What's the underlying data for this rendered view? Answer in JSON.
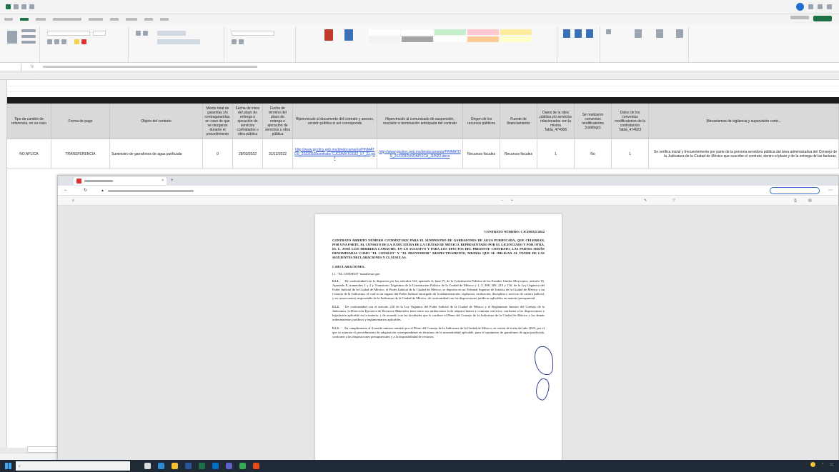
{
  "spreadsheet": {
    "headers": [
      "Tipo de cambio de referencia, en su caso",
      "Forma de pago",
      "Objeto del contrato",
      "Monto total de garantías y/o contragarantías, en caso de que se otorgaran durante el procedimiento",
      "Fecha de inicio del plazo de entrega o ejecución de servicios contratados u obra pública",
      "Fecha de término del plazo de entrega o ejecución de servicios u obra pública",
      "Hipervínculo al documento del contrato y anexos, versión pública si así corresponde",
      "Hipervínculo al comunicado de suspensión, rescisión o terminación anticipada del contrato",
      "Origen de los recursos públicos",
      "Fuente de financiamiento",
      "Datos de la obra pública y/o servicios relacionados con la misma Tabla_474906",
      "Se realizaron convenios modificatorios (catálogo)",
      "Datos de los convenios modificatorios de la contratación Tabla_474923",
      "Mecanismos de vigilancia y supervisión contr..."
    ],
    "row": [
      "NO APLICA",
      "TRANSFERENCIA",
      "Suministro de garrafones de agua purificada",
      "0",
      "28/03/2022",
      "31/12/2022",
      "http://www.pjcdmx.gob.mx/dmdocuments/PINMATDS_20220925contrato/ CJCDMXT/2022_07_21.pdf",
      "http://www.pjcdmx.gob.mx/dmdocuments/PINMATDS_20220925NOAPLICA_JUN22.docx",
      "Recursos fiscales",
      "Recursos fiscales",
      "1",
      "No",
      "1",
      "Se verifica inicial y frecuentemente por parte de la persona servidora pública del área administrativa del Consejo de la Judicatura de la Ciudad de México que suscribe el contrato, dentro el plazo y de la entrega de las facturas."
    ]
  },
  "pdf": {
    "contract_number": "CONTRATO NÚMERO: CJCDMXT/2022",
    "header_paragraph": "CONTRATO ABIERTO NÚMERO CJCDMXT/2022 PARA EL SUMINISTRO DE GARRAFONES DE AGUA PURIFICADA, QUE CELEBRAN, POR UNA PARTE, EL CONSEJO DE LA JUDICATURA DE LA CIUDAD DE MÉXICO, REPRESENTADO POR EL LICENCIADO Y POR OTRA, EL C. JOSÉ LUIS HERRERA CAMACHO, EN LO SUCESIVO Y PARA LOS EFECTOS DEL PRESENTE CONTRATO, LAS PARTES SERÁN DENOMINADAS COMO \"EL CONSEJO\" Y \"EL PROVEEDOR\" RESPECTIVAMENTE, MISMAS QUE SE OBLIGAN AL TENOR DE LAS SIGUIENTES DECLARACIONES Y CLÁUSULAS.",
    "section_title": "I.      DECLARACIONES.",
    "subsection": "I.1.     \"EL CONSEJO\" manifiesta que:",
    "paragraphs": [
      {
        "num": "I.1.1.",
        "text": "De conformidad con lo dispuesto por los artículos 122, apartado A, base IV, de la Constitución Política de los Estados Unidos Mexicanos; artículo 35, Apartado E, numerales 1 y 2 y Transitorio Trigésimo de la Constitución Política de la Ciudad de México y 1, 2, 208, 209, 210 y 216, de la Ley Orgánica del Poder Judicial de la Ciudad de México, el Poder Judicial de la Ciudad de México, se deposita en un Tribunal Superior de Justicia de la Ciudad de México y un Consejo de la Judicatura, el cual es un órgano del Poder Judicial encargado de la administración, vigilancia, evaluación, disciplina y servicio de carrera judicial, y en consecuencia responsable de la Judicatura de la Ciudad de México, de conformidad con las disposiciones jurídicas aplicables en materia presupuestal."
      },
      {
        "num": "I.1.2.",
        "text": "De conformidad con el artículo 220 de la Ley Orgánica del Poder Judicial de la Ciudad de México y el Reglamento Interior del Consejo de la Judicatura, la Dirección Ejecutiva de Recursos Materiales tiene entre sus atribuciones la de adquirir bienes y contratar servicios, conforme a las disposiciones y legislación aplicable en la materia, y de acuerdo con las facultades que le confiere el Pleno del Consejo de la Judicatura de la Ciudad de México y los demás ordenamientos jurídicos y reglamentarios aplicables."
      },
      {
        "num": "I.1.3.",
        "text": "En cumplimiento al Acuerdo número emitido por el Pleno del Consejo de la Judicatura de la Ciudad de México, en sesión de fecha del año 2022, por el que se autoriza el procedimiento de adquisición correspondiente en términos de la normatividad aplicable, para el suministro de garrafones de agua purificada, conforme a las disposiciones presupuestales y a la disponibilidad de recursos."
      }
    ]
  },
  "colors": {
    "excel_green": "#1e7145",
    "link_blue": "#1f4fcf",
    "header_gray": "#d9d9d9",
    "black_bar": "#1c1c1c",
    "taskbar": "#202a36",
    "signature_ink": "#2b3f8a"
  }
}
